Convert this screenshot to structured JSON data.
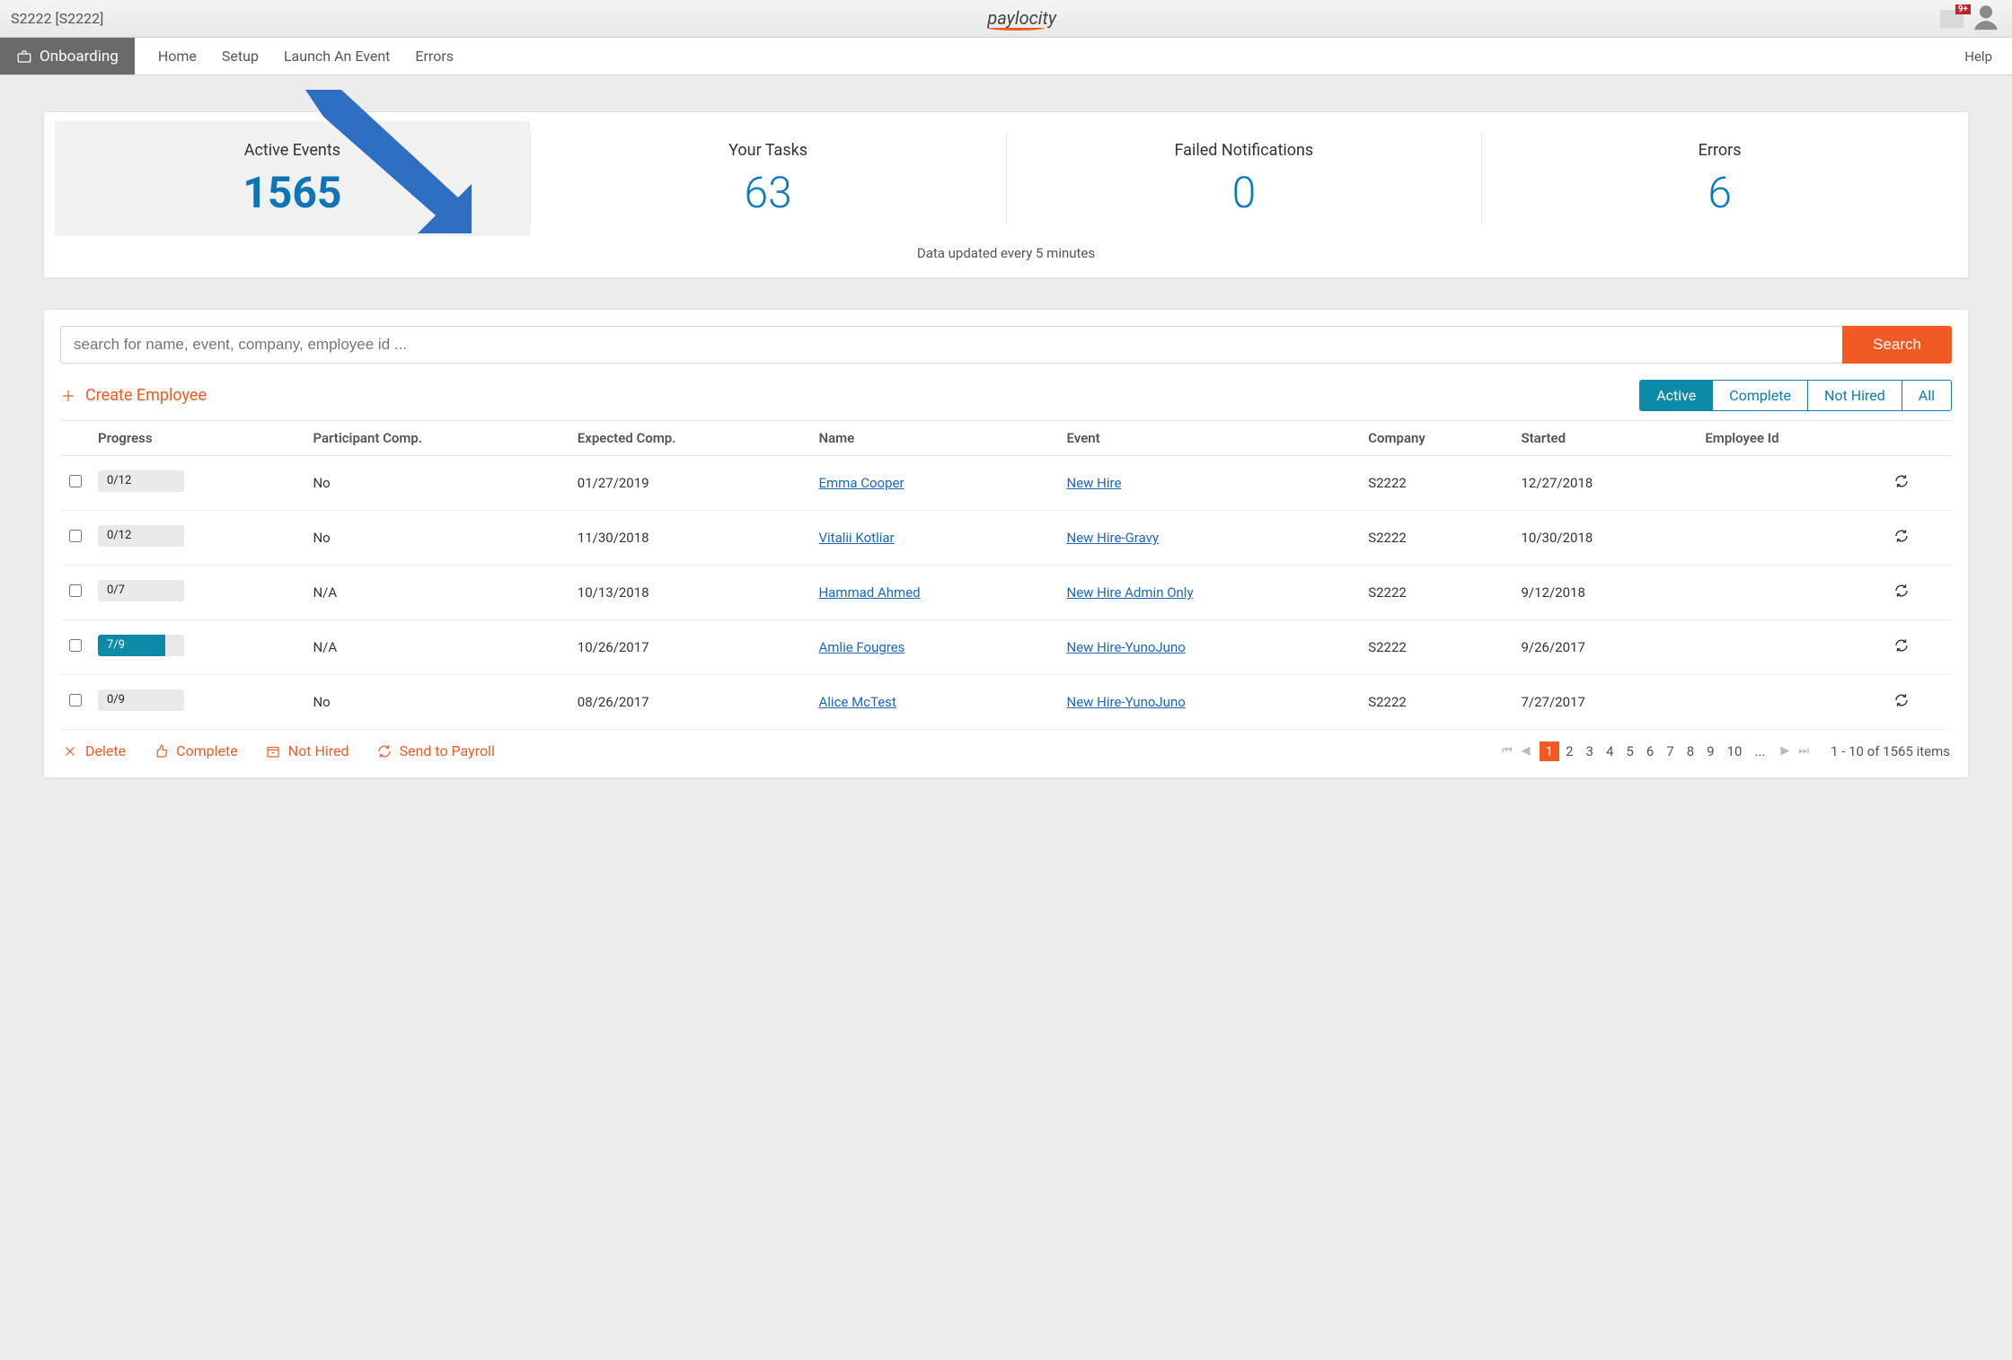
{
  "header": {
    "company_code": "S2222 [S2222]",
    "logo_text": "paylocity",
    "notif_badge": "9+"
  },
  "nav": {
    "brand": "Onboarding",
    "links": [
      "Home",
      "Setup",
      "Launch An Event",
      "Errors"
    ],
    "help": "Help"
  },
  "stats": {
    "items": [
      {
        "label": "Active Events",
        "value": "1565",
        "selected": true
      },
      {
        "label": "Your Tasks",
        "value": "63",
        "selected": false
      },
      {
        "label": "Failed Notifications",
        "value": "0",
        "selected": false
      },
      {
        "label": "Errors",
        "value": "6",
        "selected": false
      }
    ],
    "updated_text": "Data updated every 5 minutes"
  },
  "search": {
    "placeholder": "search for name, event, company, employee id ...",
    "button": "Search"
  },
  "create_label": "Create Employee",
  "filters": {
    "items": [
      "Active",
      "Complete",
      "Not Hired",
      "All"
    ],
    "active_index": 0
  },
  "columns": [
    "Progress",
    "Participant Comp.",
    "Expected Comp.",
    "Name",
    "Event",
    "Company",
    "Started",
    "Employee Id",
    ""
  ],
  "rows": [
    {
      "progress_text": "0/12",
      "progress_pct": 0,
      "participant": "No",
      "expected": "01/27/2019",
      "name": "Emma Cooper",
      "event": "New Hire",
      "company": "S2222",
      "started": "12/27/2018"
    },
    {
      "progress_text": "0/12",
      "progress_pct": 0,
      "participant": "No",
      "expected": "11/30/2018",
      "name": "Vitalii Kotliar",
      "event": "New Hire-Gravy",
      "company": "S2222",
      "started": "10/30/2018"
    },
    {
      "progress_text": "0/7",
      "progress_pct": 0,
      "participant": "N/A",
      "expected": "10/13/2018",
      "name": "Hammad Ahmed",
      "event": "New Hire Admin Only",
      "company": "S2222",
      "started": "9/12/2018"
    },
    {
      "progress_text": "7/9",
      "progress_pct": 78,
      "participant": "N/A",
      "expected": "10/26/2017",
      "name": "Amlie Fougres",
      "event": "New Hire-YunoJuno",
      "company": "S2222",
      "started": "9/26/2017"
    },
    {
      "progress_text": "0/9",
      "progress_pct": 0,
      "participant": "No",
      "expected": "08/26/2017",
      "name": "Alice McTest",
      "event": "New Hire-YunoJuno",
      "company": "S2222",
      "started": "7/27/2017"
    }
  ],
  "actions": {
    "delete": "Delete",
    "complete": "Complete",
    "not_hired": "Not Hired",
    "send": "Send to Payroll"
  },
  "pager": {
    "pages": [
      "1",
      "2",
      "3",
      "4",
      "5",
      "6",
      "7",
      "8",
      "9",
      "10",
      "..."
    ],
    "current": 0,
    "items_text": "1 - 10 of 1565 items"
  }
}
